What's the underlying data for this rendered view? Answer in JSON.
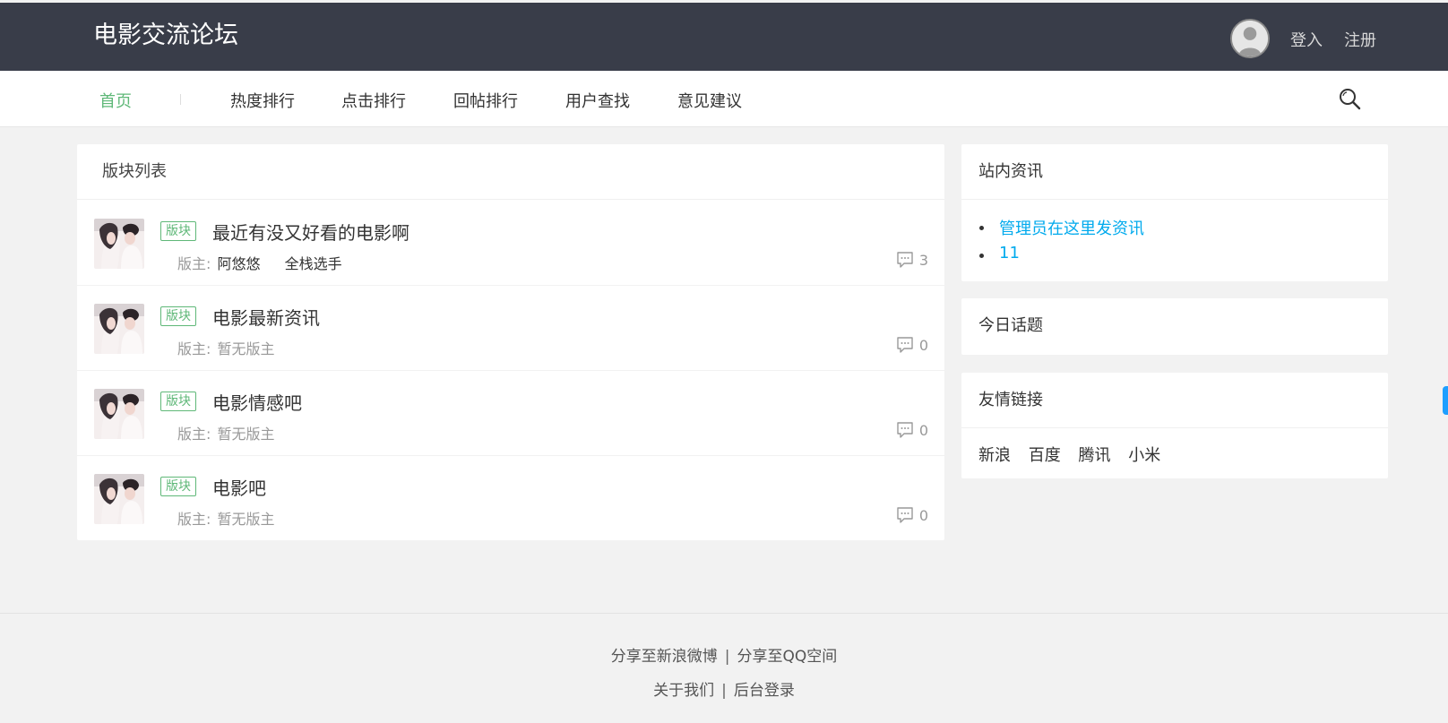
{
  "header": {
    "site_title": "电影交流论坛",
    "login": "登入",
    "register": "注册"
  },
  "nav": {
    "items": [
      {
        "label": "首页",
        "active": true
      },
      {
        "label": "热度排行"
      },
      {
        "label": "点击排行"
      },
      {
        "label": "回帖排行"
      },
      {
        "label": "用户查找"
      },
      {
        "label": "意见建议"
      }
    ]
  },
  "main": {
    "panel_title": "版块列表",
    "boards": [
      {
        "tag": "版块",
        "title": "最近有没又好看的电影啊",
        "mod_label": "版主:",
        "mods": [
          "阿悠悠",
          "全栈选手"
        ],
        "count": "3"
      },
      {
        "tag": "版块",
        "title": "电影最新资讯",
        "mod_label": "版主:",
        "mod_none": "暂无版主",
        "count": "0"
      },
      {
        "tag": "版块",
        "title": "电影情感吧",
        "mod_label": "版主:",
        "mod_none": "暂无版主",
        "count": "0"
      },
      {
        "tag": "版块",
        "title": "电影吧",
        "mod_label": "版主:",
        "mod_none": "暂无版主",
        "count": "0"
      }
    ]
  },
  "sidebar": {
    "news": {
      "title": "站内资讯",
      "items": [
        "管理员在这里发资讯",
        "11"
      ]
    },
    "today": {
      "title": "今日话题"
    },
    "links": {
      "title": "友情链接",
      "items": [
        "新浪",
        "百度",
        "腾讯",
        "小米"
      ]
    }
  },
  "footer": {
    "share_weibo": "分享至新浪微博",
    "share_qq": "分享至QQ空间",
    "about": "关于我们",
    "admin_login": "后台登录",
    "separator": "|"
  },
  "colors": {
    "header_bg": "#393d49",
    "accent_green": "#5fb878",
    "link_blue": "#01aaed"
  }
}
